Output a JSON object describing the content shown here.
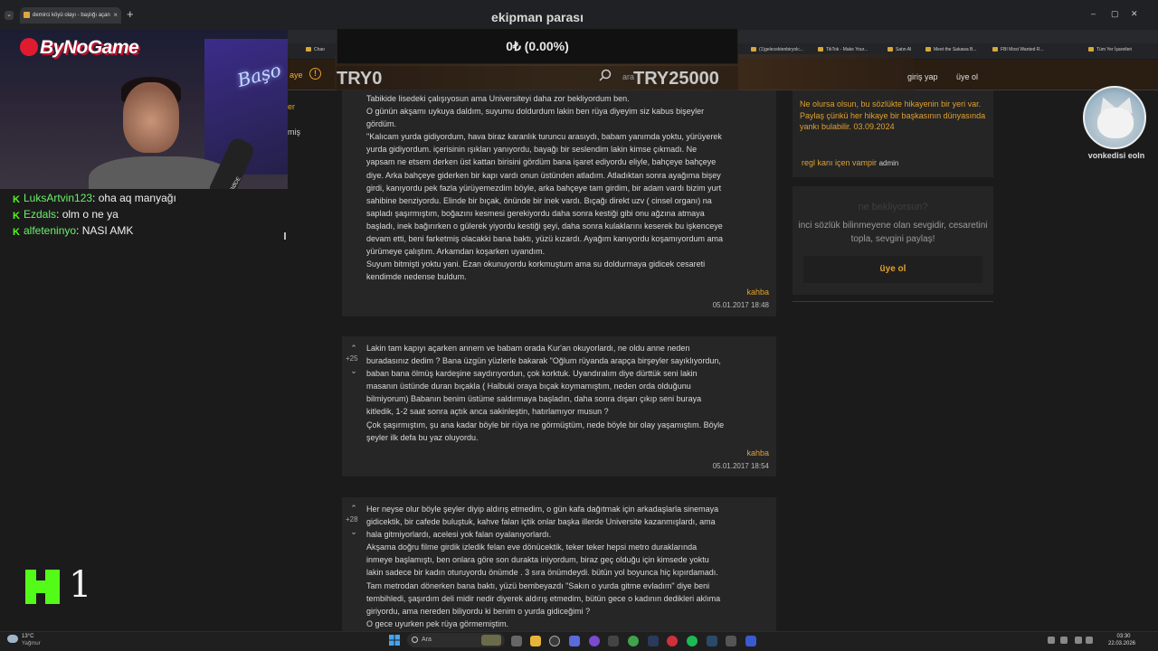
{
  "browser": {
    "tab_title": "demirci köyü olayı - başlığı açan",
    "tab_close": "×",
    "new_tab": "+",
    "bookmarks": [
      "Chao",
      "(1)gelecektenbiryolc...",
      "TikTok - Make Your...",
      "Satın Al",
      "Meet the Sakawa B...",
      "FBI Most Wanted R...",
      "Tüm Yer İşaretleri"
    ],
    "accent": "#e0a030"
  },
  "donation": {
    "title": "ekipman parası",
    "amount": "0₺ (0.00%)",
    "min": "TRY0",
    "max": "TRY25000",
    "progress": 0
  },
  "site_header": {
    "left_label": "aye",
    "search_fragment": "ara",
    "login": "giriş yap",
    "signup": "üye ol",
    "side_fragments": [
      "er",
      "miş"
    ]
  },
  "stream": {
    "logo": "ByNoGame",
    "neon": "Başo",
    "mic_brand": "RØDE"
  },
  "chat": [
    {
      "user": "LuksArtvin123",
      "message": "oha aq manyağı"
    },
    {
      "user": "Ezdals",
      "message": "olm o ne ya"
    },
    {
      "user": "alfeteninyo",
      "message": "NASI AMK"
    }
  ],
  "kick": {
    "number": "1"
  },
  "entries": [
    {
      "lines": [
        "Tabikide lisedeki çalışıyosun ama Universiteyi daha zor bekliyordum ben.",
        "O günün akşamı uykuya daldım, suyumu doldurdum lakin ben rüya diyeyim siz kabus bişeyler",
        "gördüm.",
        "\"Kalıcam yurda gidiyordum, hava biraz karanlık turuncu arasıydı, babam yanımda yoktu, yürüyerek",
        "yurda gidiyordum. içerisinin ışıkları yanıyordu, bayağı bir seslendim lakin kimse çıkmadı. Ne",
        "yapsam ne etsem derken üst kattan birisini gördüm bana işaret ediyordu eliyle, bahçeye bahçeye",
        "diye. Arka bahçeye giderken bir kapı vardı onun üstünden atladım. Atladıktan sonra ayağıma bişey",
        "girdi, kanıyordu pek fazla yürüyemezdim böyle, arka bahçeye tam girdim, bir adam vardı bizim yurt",
        "sahibine benziyordu. Elinde bir bıçak, önünde bir inek vardı. Bıçağı direkt uzv ( cinsel organı) na",
        "sapladı şaşırmıştım, boğazını kesmesi gerekiyordu daha sonra kestiği gibi onu ağzına atmaya",
        "başladı, inek bağırırken o gülerek yiyordu kestiği şeyi, daha sonra kulaklarını keserek bu işkenceye",
        "devam etti, beni farketmiş olacakki bana baktı, yüzü kızardı. Ayağım kanıyordu koşamıyordum ama",
        "yürümeye çalıştım. Arkamdan koşarken uyandım.",
        "Suyum bitmişti yoktu yani. Ezan okunuyordu korkmuştum ama su doldurmaya gidicek cesareti",
        "kendimde nedense buldum."
      ],
      "author": "kahba",
      "date": "05.01.2017 18:48"
    },
    {
      "lines": [
        "Lakin tam kapıyı açarken annem ve babam orada Kur'an okuyorlardı, ne oldu anne neden",
        "buradasınız dedim ? Bana üzgün yüzlerle bakarak \"Oğlum rüyanda arapça birşeyler sayıklıyordun,",
        "baban bana ölmüş kardeşine saydırıyordun, çok korktuk. Uyandıralım diye dürttük seni lakin",
        "masanın üstünde duran bıçakla ( Halbuki oraya bıçak koymamıştım, neden orda olduğunu",
        "bilmiyorum) Babanın benim üstüme saldırmaya başladın, daha sonra dışarı çıkıp seni buraya",
        "kitledik, 1-2 saat sonra açtık anca sakinleştin, hatırlamıyor musun ?",
        "Çok şaşırmıştım, şu ana kadar böyle bir rüya ne görmüştüm, nede böyle bir olay yaşamıştım. Böyle",
        "şeyler ilk defa bu yaz oluyordu."
      ],
      "votes": "+25",
      "author": "kahba",
      "date": "05.01.2017 18:54"
    },
    {
      "lines": [
        "Her neyse olur böyle şeyler diyip aldırış etmedim, o gün kafa dağıtmak için arkadaşlarla sinemaya",
        "gidicektik, bir cafede buluştuk, kahve falan içtik onlar başka illerde Universite kazanmışlardı, ama",
        "hala gitmiyorlardı, acelesi yok falan oyalanıyorlardı.",
        "Akşama doğru filme girdik izledik felan eve dönücektik, teker teker hepsi metro duraklarında",
        "inmeye başlamıştı, ben onlara göre son durakta iniyordum, biraz geç olduğu için kimsede yoktu",
        "lakin sadece bir kadın oturuyordu önümde . 3 sıra önümdeydi. bütün yol boyunca hiç kıpırdamadı.",
        "Tam metrodan dönerken bana baktı, yüzü bembeyazdı \"Sakın o yurda gitme evladım\" diye beni",
        "tembihledi, şaşırdım deli midir nedir diyerek aldırış etmedim, bütün gece o kadının dedikleri aklıma",
        "giriyordu, ama nereden biliyordu ki benim o yurda gidiceğimi ?",
        "O gece uyurken pek rüya görmemiştim."
      ],
      "votes": "+28"
    }
  ],
  "right_sidebar": {
    "quote": "Ne olursa olsun, bu sözlükte hikayenin bir yeri var. Paylaş çünkü her hikaye bir başkasının dünyasında yankı bulabilir. 03.09.2024",
    "quote_author": "regl kanı içen vampir",
    "quote_role": "admin",
    "cta_title": "ne bekliyorsun?",
    "cta_desc": "inci sözlük bilinmeyene olan sevgidir, cesaretini topla, sevgini paylaş!",
    "cta_button": "üye ol"
  },
  "avatar": {
    "name": "vonkedisi eoln"
  },
  "taskbar": {
    "weather_temp": "13°C",
    "weather_desc": "Yağmur",
    "search": "Ara",
    "time": "03:30",
    "date": "22.03.2026"
  }
}
